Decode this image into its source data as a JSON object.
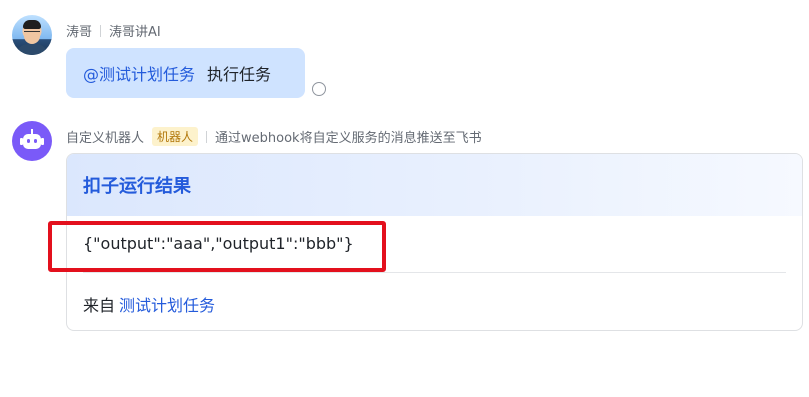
{
  "messages": [
    {
      "sender": "涛哥",
      "group": "涛哥讲AI",
      "mention": "@测试计划任务",
      "text": "执行任务"
    },
    {
      "sender": "自定义机器人",
      "badge": "机器人",
      "description": "通过webhook将自定义服务的消息推送至飞书",
      "card": {
        "title": "扣子运行结果",
        "content": "{\"output\":\"aaa\",\"output1\":\"bbb\"}",
        "footer_prefix": "来自",
        "footer_link": "测试计划任务"
      }
    }
  ],
  "colors": {
    "accent": "#245bdb",
    "bubble_bg": "#cfe3ff",
    "bot_avatar": "#7a5af8",
    "highlight": "#e3101d",
    "badge_bg": "#fdf2cc"
  },
  "icons": {
    "user_avatar": "person-avatar-icon",
    "bot_avatar": "robot-icon",
    "read_status": "read-status-circle-icon"
  }
}
